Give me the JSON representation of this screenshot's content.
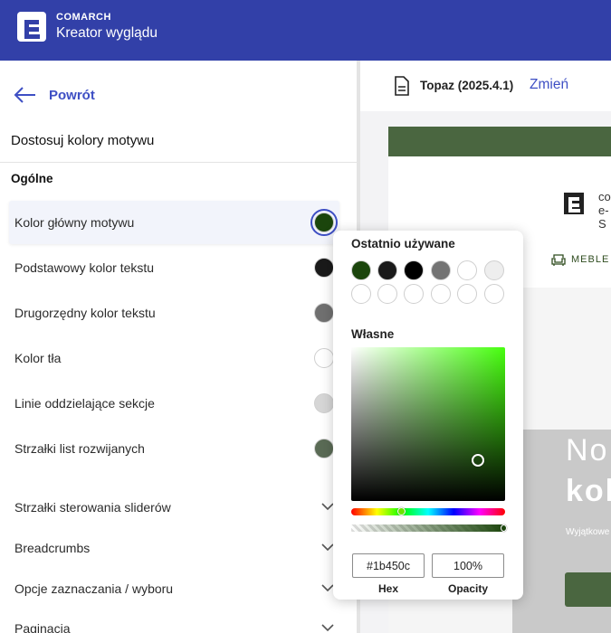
{
  "header": {
    "brand": "COMARCH",
    "app_title": "Kreator wyglądu",
    "accent": "#3240a8"
  },
  "left": {
    "back_label": "Powrót",
    "section_title": "Dostosuj kolory motywu",
    "group_title": "Ogólne",
    "color_rows": [
      {
        "label": "Kolor główny motywu",
        "color": "#1b450c"
      },
      {
        "label": "Podstawowy kolor tekstu",
        "color": "#1a1a1a"
      },
      {
        "label": "Drugorzędny kolor tekstu",
        "color": "#707070"
      },
      {
        "label": "Kolor tła",
        "color": "#ffffff"
      },
      {
        "label": "Linie oddzielające sekcje",
        "color": "#d6d6d6"
      },
      {
        "label": "Strzałki list rozwijanych",
        "color": "#5a6b55"
      }
    ],
    "collapsible": [
      {
        "label": "Strzałki sterowania sliderów",
        "icon": "chevron-down-icon"
      },
      {
        "label": "Breadcrumbs",
        "icon": "chevron-down-icon"
      },
      {
        "label": "Opcje zaznaczania / wyboru",
        "icon": "chevron-down-icon"
      },
      {
        "label": "Paginacja",
        "icon": "chevron-down-icon"
      }
    ]
  },
  "right": {
    "theme_name": "Topaz (2025.4.1)",
    "change_label": "Zmień",
    "preview": {
      "logo_text_line1": "co",
      "logo_text_line2": "e-S",
      "nav_item": "MEBLE",
      "hero_line1": "No",
      "hero_line2": "kol",
      "hero_sub": "Wyjątkowe"
    }
  },
  "picker": {
    "recent_title": "Ostatnio używane",
    "recent_colors": [
      "#1b450c",
      "#1a1a1a",
      "#000000",
      "#737373",
      "#ffffff",
      "#eeeeee",
      "#ffffff",
      "#ffffff",
      "#ffffff",
      "#ffffff",
      "#ffffff",
      "#ffffff"
    ],
    "custom_title": "Własne",
    "hex_value": "#1b450c",
    "opacity_value": "100%",
    "hex_label": "Hex",
    "opacity_label": "Opacity"
  }
}
